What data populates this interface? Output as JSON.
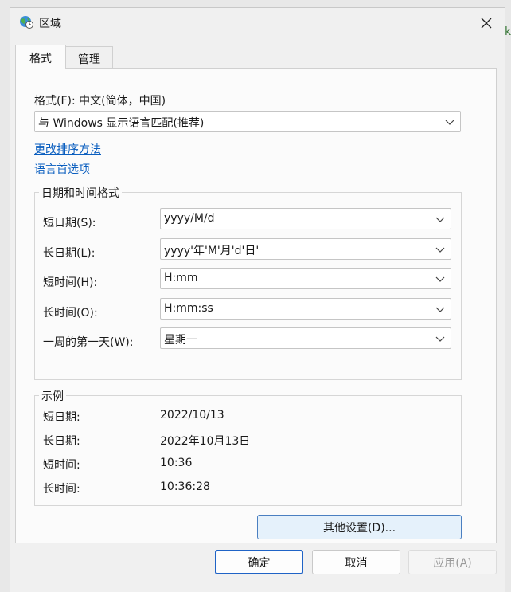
{
  "window": {
    "title": "区域",
    "background_glyph": "k"
  },
  "icons": {
    "app": "globe-clock-icon",
    "close": "close-icon",
    "chevron": "chevron-down-icon"
  },
  "tabs": [
    {
      "label": "格式",
      "active": true
    },
    {
      "label": "管理",
      "active": false
    }
  ],
  "format": {
    "label": "格式(F): 中文(简体，中国)",
    "selected": "与 Windows 显示语言匹配(推荐)"
  },
  "links": {
    "sort": "更改排序方法",
    "language": "语言首选项"
  },
  "datetime": {
    "title": "日期和时间格式",
    "rows": [
      {
        "label": "短日期(S):",
        "value": "yyyy/M/d"
      },
      {
        "label": "长日期(L):",
        "value": "yyyy'年'M'月'd'日'"
      },
      {
        "label": "短时间(H):",
        "value": "H:mm"
      },
      {
        "label": "长时间(O):",
        "value": "H:mm:ss"
      },
      {
        "label": "一周的第一天(W):",
        "value": "星期一"
      }
    ]
  },
  "examples": {
    "title": "示例",
    "rows": [
      {
        "label": "短日期:",
        "value": "2022/10/13"
      },
      {
        "label": "长日期:",
        "value": "2022年10月13日"
      },
      {
        "label": "短时间:",
        "value": "10:36"
      },
      {
        "label": "长时间:",
        "value": "10:36:28"
      }
    ]
  },
  "buttons": {
    "other": "其他设置(D)...",
    "ok": "确定",
    "cancel": "取消",
    "apply": "应用(A)"
  },
  "colors": {
    "accent": "#1f63c6",
    "link": "#0a5ebf",
    "disabled": "#9a9a9a"
  }
}
